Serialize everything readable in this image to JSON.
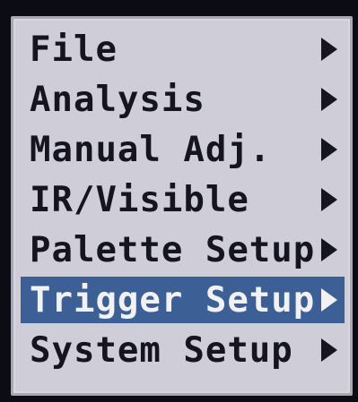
{
  "menu": {
    "items": [
      {
        "label": "File",
        "selected": false
      },
      {
        "label": "Analysis",
        "selected": false
      },
      {
        "label": "Manual Adj.",
        "selected": false
      },
      {
        "label": "IR/Visible",
        "selected": false
      },
      {
        "label": "Palette Setup",
        "selected": false
      },
      {
        "label": "Trigger Setup",
        "selected": true
      },
      {
        "label": "System Setup",
        "selected": false
      }
    ]
  },
  "colors": {
    "menu_background": "#cfcdd7",
    "text": "#141521",
    "selected_background": "#3c5f96",
    "selected_text": "#f2f2f6",
    "screen_border": "#0c0c14"
  },
  "icons": {
    "submenu": "chevron-right-icon"
  }
}
